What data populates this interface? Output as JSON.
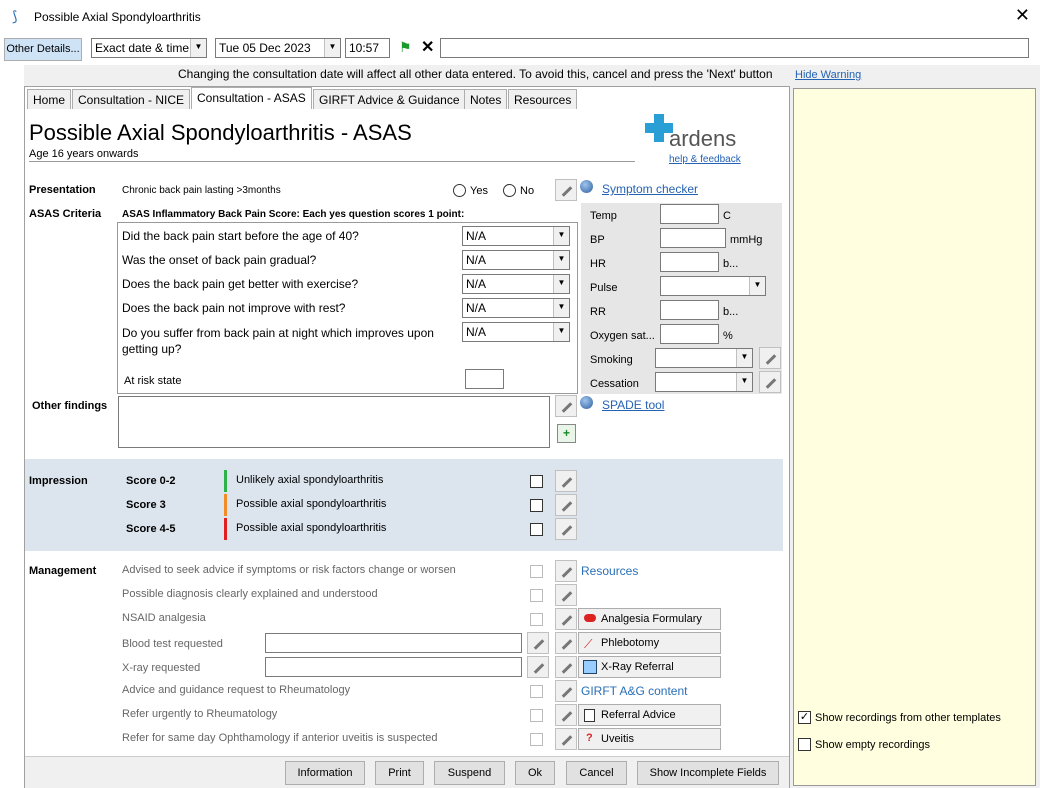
{
  "window": {
    "title": "Possible Axial Spondyloarthritis"
  },
  "toolbar": {
    "other_details": "Other Details...",
    "date_mode": "Exact date & time",
    "date": "Tue 05 Dec 2023",
    "time": "10:57",
    "warning": "Changing the consultation date will affect all other data entered. To avoid this, cancel and press the 'Next' button",
    "hide_warning": "Hide Warning"
  },
  "tabs": [
    "Home",
    "Consultation - NICE",
    "Consultation - ASAS",
    "GIRFT Advice & Guidance",
    "Notes",
    "Resources"
  ],
  "header": {
    "title": "Possible Axial Spondyloarthritis - ASAS",
    "subtitle": "Age 16 years onwards",
    "brand": "ardens",
    "help": "help & feedback"
  },
  "presentation": {
    "label": "Presentation",
    "text": "Chronic back pain lasting >3months",
    "yes": "Yes",
    "no": "No",
    "symptom_checker": "Symptom checker"
  },
  "asas": {
    "label": "ASAS Criteria",
    "heading": "ASAS Inflammatory Back Pain Score: Each yes question scores 1 point:",
    "questions": [
      {
        "q": "Did the back pain start before the age of 40?",
        "v": "N/A"
      },
      {
        "q": "Was the onset of back pain gradual?",
        "v": "N/A"
      },
      {
        "q": "Does the back pain get better with exercise?",
        "v": "N/A"
      },
      {
        "q": "Does the back pain not improve with rest?",
        "v": "N/A"
      },
      {
        "q": "Do you suffer from back pain at night which improves upon getting up?",
        "v": "N/A"
      }
    ],
    "at_risk": "At risk state"
  },
  "vitals": {
    "temp": "Temp",
    "temp_u": "C",
    "bp": "BP",
    "bp_u": "mmHg",
    "hr": "HR",
    "hr_u": "b...",
    "pulse": "Pulse",
    "rr": "RR",
    "rr_u": "b...",
    "oxy": "Oxygen sat...",
    "oxy_u": "%",
    "smoking": "Smoking",
    "cessation": "Cessation"
  },
  "other": {
    "label": "Other findings",
    "spade": "SPADE tool"
  },
  "impression": {
    "label": "Impression",
    "rows": [
      {
        "score": "Score 0-2",
        "text": "Unlikely axial spondyloarthritis",
        "color": "#2db34a"
      },
      {
        "score": "Score 3",
        "text": "Possible axial spondyloarthritis",
        "color": "#f28c28"
      },
      {
        "score": "Score 4-5",
        "text": "Possible axial spondyloarthritis",
        "color": "#e02020"
      }
    ]
  },
  "management": {
    "label": "Management",
    "items": [
      "Advised to seek advice if symptoms or risk factors change or worsen",
      "Possible diagnosis clearly explained and understood",
      "NSAID analgesia",
      "Blood test requested",
      "X-ray requested",
      "Advice and guidance request to Rheumatology",
      "Refer urgently to Rheumatology",
      "Refer for same day Ophthamology if anterior uveitis is suspected"
    ],
    "resources": "Resources",
    "analgesia": "Analgesia Formulary",
    "phlebotomy": "Phlebotomy",
    "xray": "X-Ray Referral",
    "girft": "GIRFT A&G content",
    "referral": "Referral Advice",
    "uveitis": "Uveitis"
  },
  "right": {
    "show_other": "Show recordings from other templates",
    "show_empty": "Show empty recordings"
  },
  "footer": {
    "information": "Information",
    "print": "Print",
    "suspend": "Suspend",
    "ok": "Ok",
    "cancel": "Cancel",
    "incomplete": "Show Incomplete Fields"
  }
}
